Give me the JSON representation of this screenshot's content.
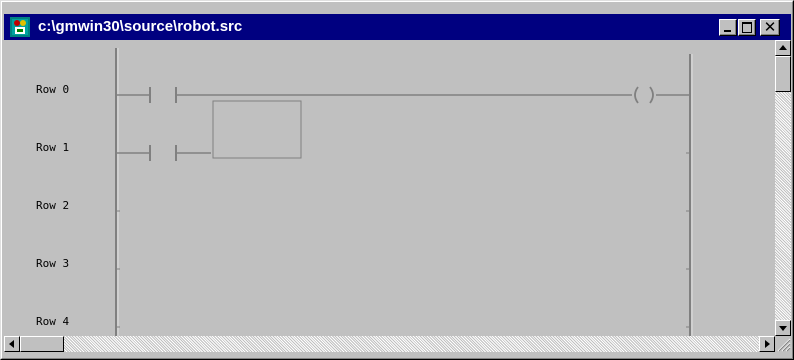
{
  "window": {
    "title": "c:\\gmwin30\\source\\robot.src",
    "close_glyph": "✕"
  },
  "ladder": {
    "rows": [
      {
        "label": "Row 0"
      },
      {
        "label": "Row 1"
      },
      {
        "label": "Row 2"
      },
      {
        "label": "Row 3"
      },
      {
        "label": "Row 4"
      }
    ],
    "coil_symbol": "( )"
  },
  "icons": {
    "app": "app-icon",
    "minimize": "minimize-icon",
    "maximize": "maximize-icon",
    "close": "close-icon"
  },
  "colors": {
    "titlebar": "#000080",
    "face": "#c0c0c0",
    "rail": "#808080"
  }
}
